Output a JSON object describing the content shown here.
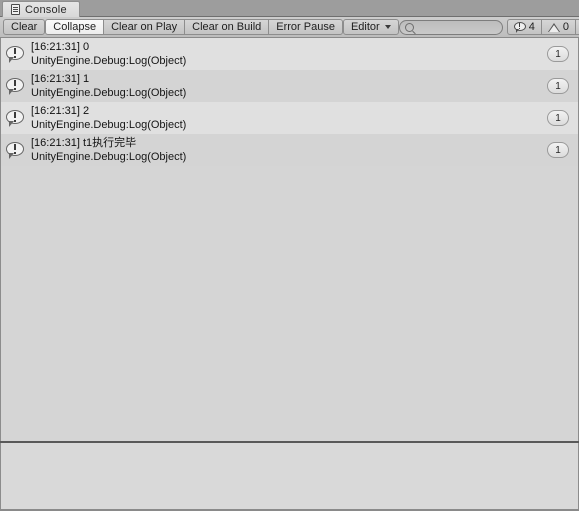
{
  "window": {
    "title": "Console",
    "tab_icon": "console-list-icon"
  },
  "toolbar": {
    "buttons": [
      {
        "label": "Clear",
        "state": "off",
        "name": "clear-button"
      },
      {
        "label": "Collapse",
        "state": "on",
        "name": "collapse-button"
      },
      {
        "label": "Clear on Play",
        "state": "off",
        "name": "clear-on-play-button"
      },
      {
        "label": "Clear on Build",
        "state": "off",
        "name": "clear-on-build-button"
      },
      {
        "label": "Error Pause",
        "state": "off",
        "name": "error-pause-button"
      }
    ],
    "dropdown": {
      "label": "Editor",
      "icon": "chevron-down-icon"
    },
    "search": {
      "value": "",
      "placeholder": "",
      "icon": "search-icon"
    },
    "counters": {
      "log": {
        "icon": "log-icon",
        "count": "4"
      },
      "warning": {
        "icon": "warning-icon",
        "count": "0"
      },
      "error": {
        "icon": "error-icon",
        "count": ""
      }
    }
  },
  "log": {
    "entries": [
      {
        "icon": "log-icon",
        "message": "[16:21:31] 0",
        "stacktrace": "UnityEngine.Debug:Log(Object)",
        "count": "1"
      },
      {
        "icon": "log-icon",
        "message": "[16:21:31] 1",
        "stacktrace": "UnityEngine.Debug:Log(Object)",
        "count": "1"
      },
      {
        "icon": "log-icon",
        "message": "[16:21:31] 2",
        "stacktrace": "UnityEngine.Debug:Log(Object)",
        "count": "1"
      },
      {
        "icon": "log-icon",
        "message": "[16:21:31] t1执行完毕",
        "stacktrace": "UnityEngine.Debug:Log(Object)",
        "count": "1"
      }
    ]
  },
  "detail": {
    "text": ""
  },
  "colors": {
    "chrome": "#bdbdbd",
    "row_odd": "#e0e0e0",
    "row_even": "#d4d4d4",
    "pane": "#d5d5d5",
    "border": "#8c8c8c",
    "text": "#1b1b1b"
  }
}
